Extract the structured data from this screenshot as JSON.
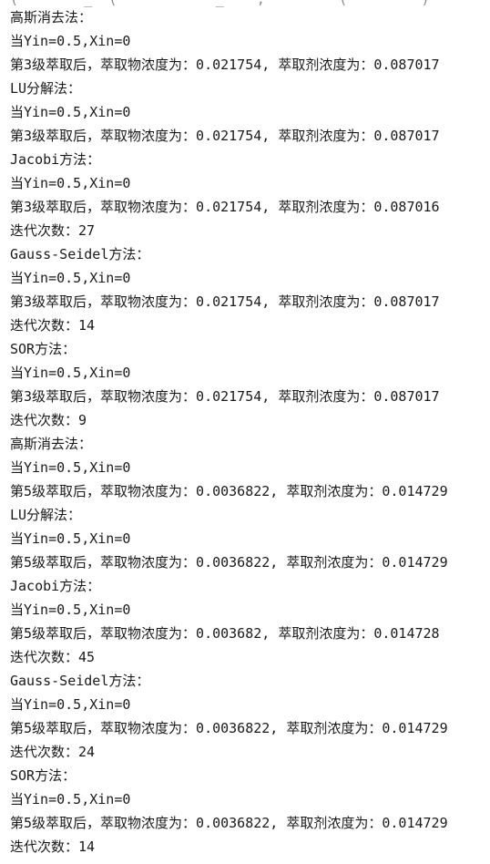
{
  "console": {
    "clipped_top": "(        _  (            _    ,         (         ) ",
    "lines": [
      "高斯消去法：",
      "当Yin=0.5,Xin=0",
      "第3级萃取后，萃取物浓度为：0.021754, 萃取剂浓度为：0.087017",
      "LU分解法：",
      "当Yin=0.5,Xin=0",
      "第3级萃取后，萃取物浓度为：0.021754, 萃取剂浓度为：0.087017",
      "Jacobi方法：",
      "当Yin=0.5,Xin=0",
      "第3级萃取后，萃取物浓度为：0.021754, 萃取剂浓度为：0.087016",
      "迭代次数：27",
      "Gauss-Seidel方法：",
      "当Yin=0.5,Xin=0",
      "第3级萃取后，萃取物浓度为：0.021754, 萃取剂浓度为：0.087017",
      "迭代次数：14",
      "SOR方法：",
      "当Yin=0.5,Xin=0",
      "第3级萃取后，萃取物浓度为：0.021754, 萃取剂浓度为：0.087017",
      "迭代次数：9",
      "高斯消去法：",
      "当Yin=0.5,Xin=0",
      "第5级萃取后，萃取物浓度为：0.0036822, 萃取剂浓度为：0.014729",
      "LU分解法：",
      "当Yin=0.5,Xin=0",
      "第5级萃取后，萃取物浓度为：0.0036822, 萃取剂浓度为：0.014729",
      "Jacobi方法：",
      "当Yin=0.5,Xin=0",
      "第5级萃取后，萃取物浓度为：0.003682, 萃取剂浓度为：0.014728",
      "迭代次数：45",
      "Gauss-Seidel方法：",
      "当Yin=0.5,Xin=0",
      "第5级萃取后，萃取物浓度为：0.0036822, 萃取剂浓度为：0.014729",
      "迭代次数：24",
      "SOR方法：",
      "当Yin=0.5,Xin=0",
      "第5级萃取后，萃取物浓度为：0.0036822, 萃取剂浓度为：0.014729",
      "迭代次数：14"
    ]
  }
}
